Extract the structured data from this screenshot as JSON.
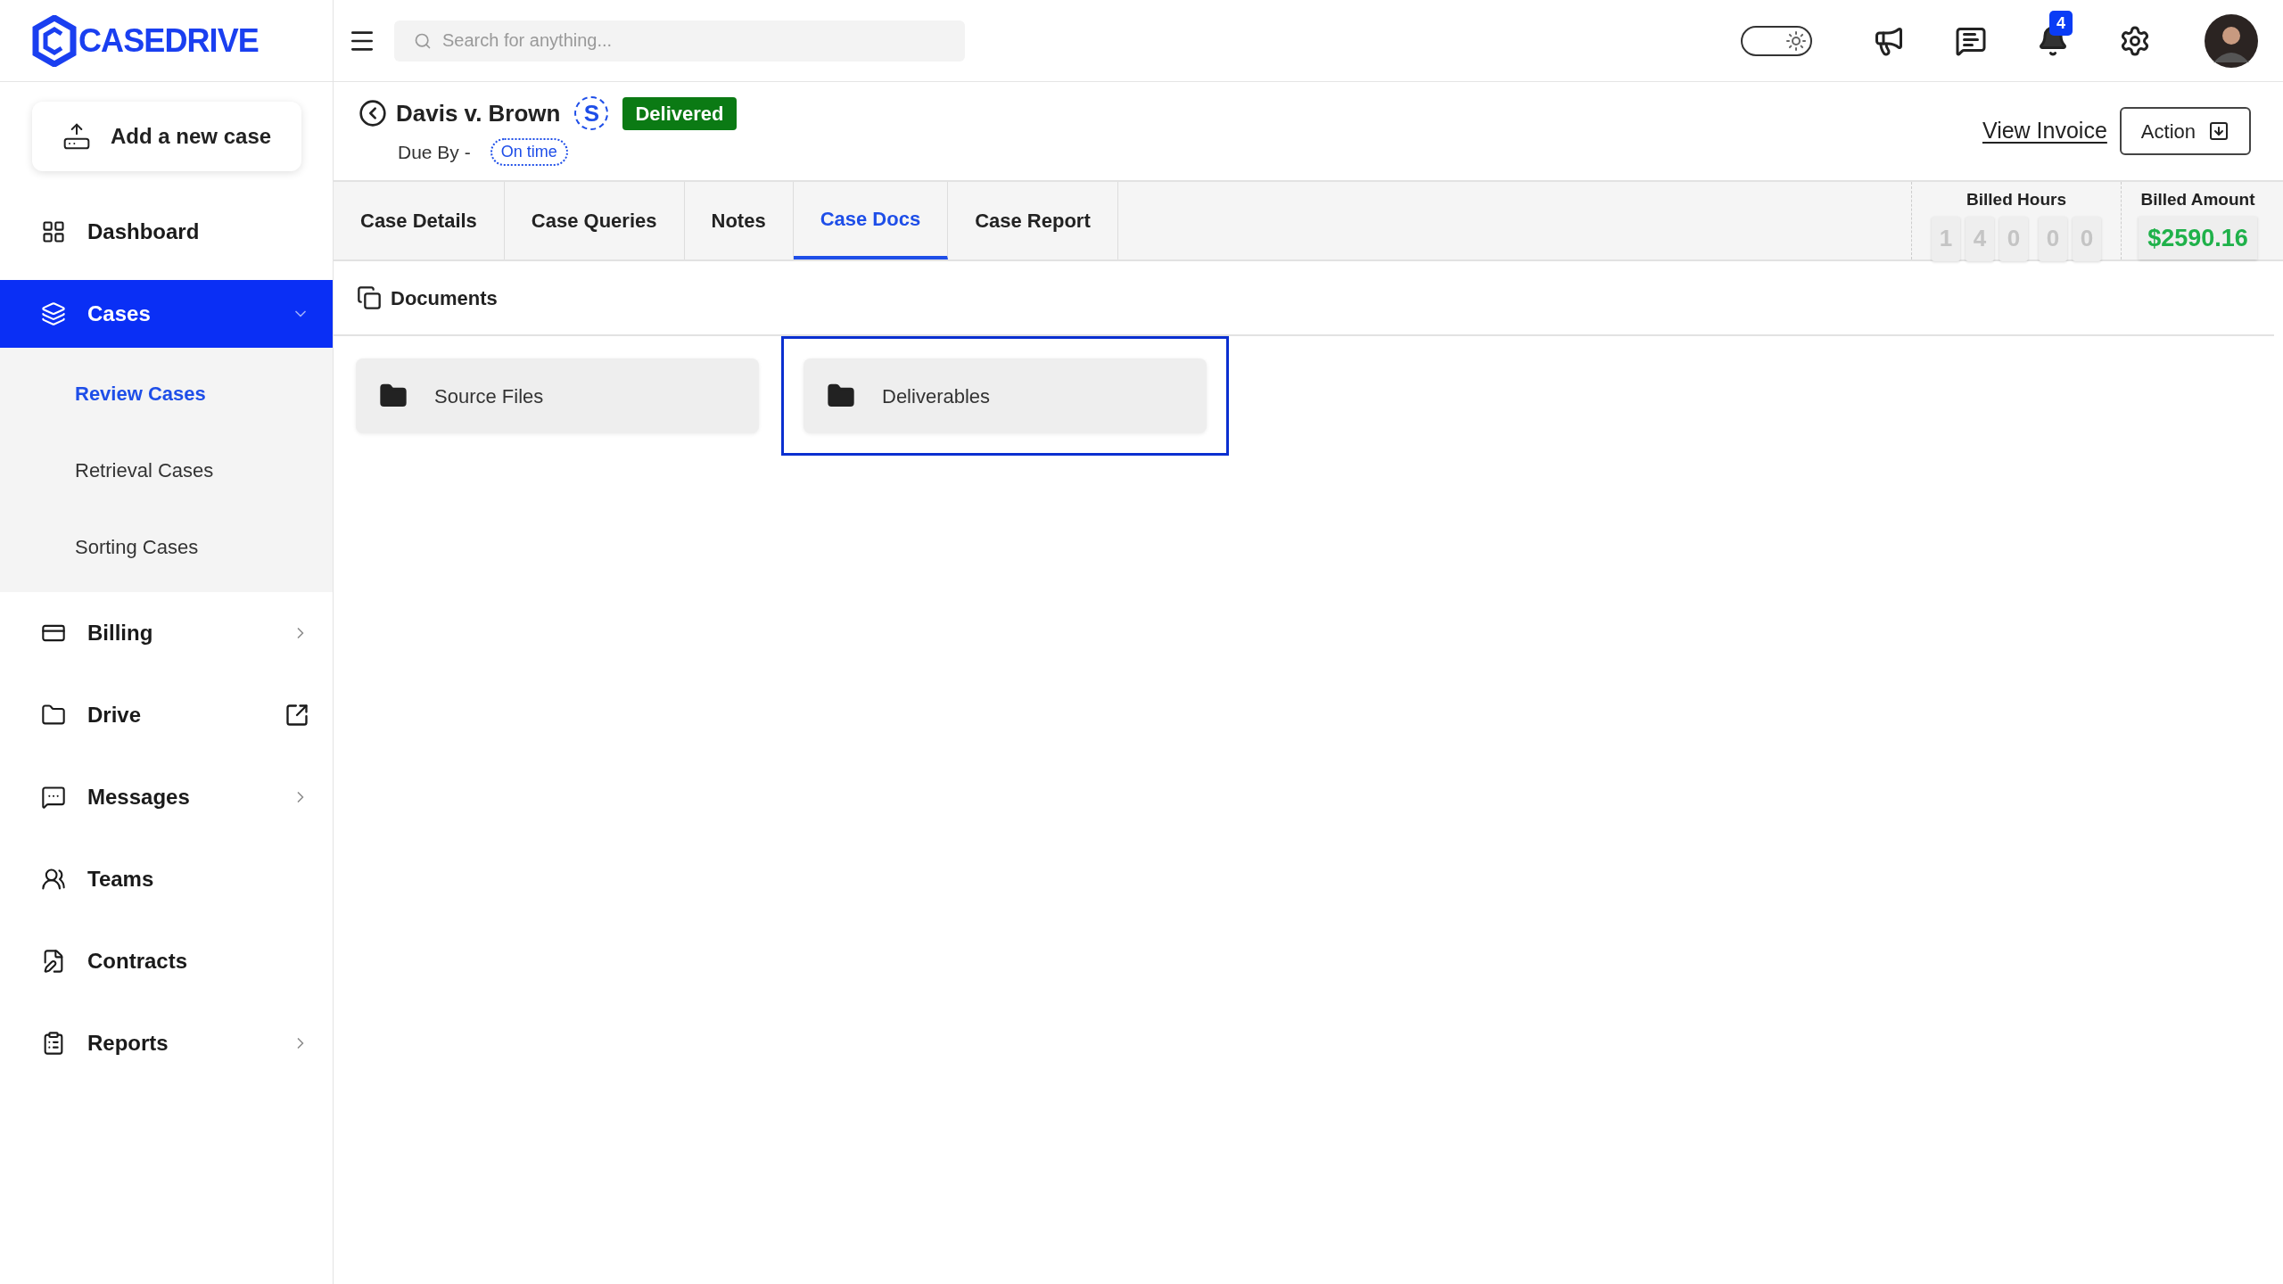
{
  "logo": {
    "text": "CASEDRIVE"
  },
  "search": {
    "placeholder": "Search for anything..."
  },
  "theme_toggle": {
    "on": true
  },
  "notifications": {
    "count": "4"
  },
  "sidebar": {
    "add_button": "Add a new case",
    "items": [
      {
        "label": "Dashboard",
        "selected": false,
        "kind": "plain"
      },
      {
        "label": "Cases",
        "selected": true,
        "kind": "chevron",
        "expanded": true,
        "children": [
          {
            "label": "Review Cases",
            "selected": true
          },
          {
            "label": "Retrieval Cases",
            "selected": false
          },
          {
            "label": "Sorting Cases",
            "selected": false
          }
        ]
      },
      {
        "label": "Billing",
        "selected": false,
        "kind": "chevron"
      },
      {
        "label": "Drive",
        "selected": false,
        "kind": "external"
      },
      {
        "label": "Messages",
        "selected": false,
        "kind": "chevron"
      },
      {
        "label": "Teams",
        "selected": false,
        "kind": "plain"
      },
      {
        "label": "Contracts",
        "selected": false,
        "kind": "plain"
      },
      {
        "label": "Reports",
        "selected": false,
        "kind": "chevron"
      }
    ]
  },
  "case": {
    "title": "Davis v. Brown",
    "initial": "S",
    "status": "Delivered",
    "due_label": "Due By -",
    "due_status": "On time",
    "view_invoice": "View Invoice",
    "action": "Action"
  },
  "tabs": [
    {
      "label": "Case Details",
      "selected": false
    },
    {
      "label": "Case Queries",
      "selected": false
    },
    {
      "label": "Notes",
      "selected": false
    },
    {
      "label": "Case Docs",
      "selected": true
    },
    {
      "label": "Case Report",
      "selected": false
    }
  ],
  "billed_hours": {
    "label": "Billed Hours",
    "groups": [
      [
        "1",
        "4",
        "0"
      ],
      [
        "0",
        "0"
      ]
    ]
  },
  "billed_amount": {
    "label": "Billed Amount",
    "value": "$2590.16"
  },
  "documents": {
    "title": "Documents",
    "folders": [
      {
        "name": "Source Files",
        "selected": false
      },
      {
        "name": "Deliverables",
        "selected": true
      }
    ]
  }
}
